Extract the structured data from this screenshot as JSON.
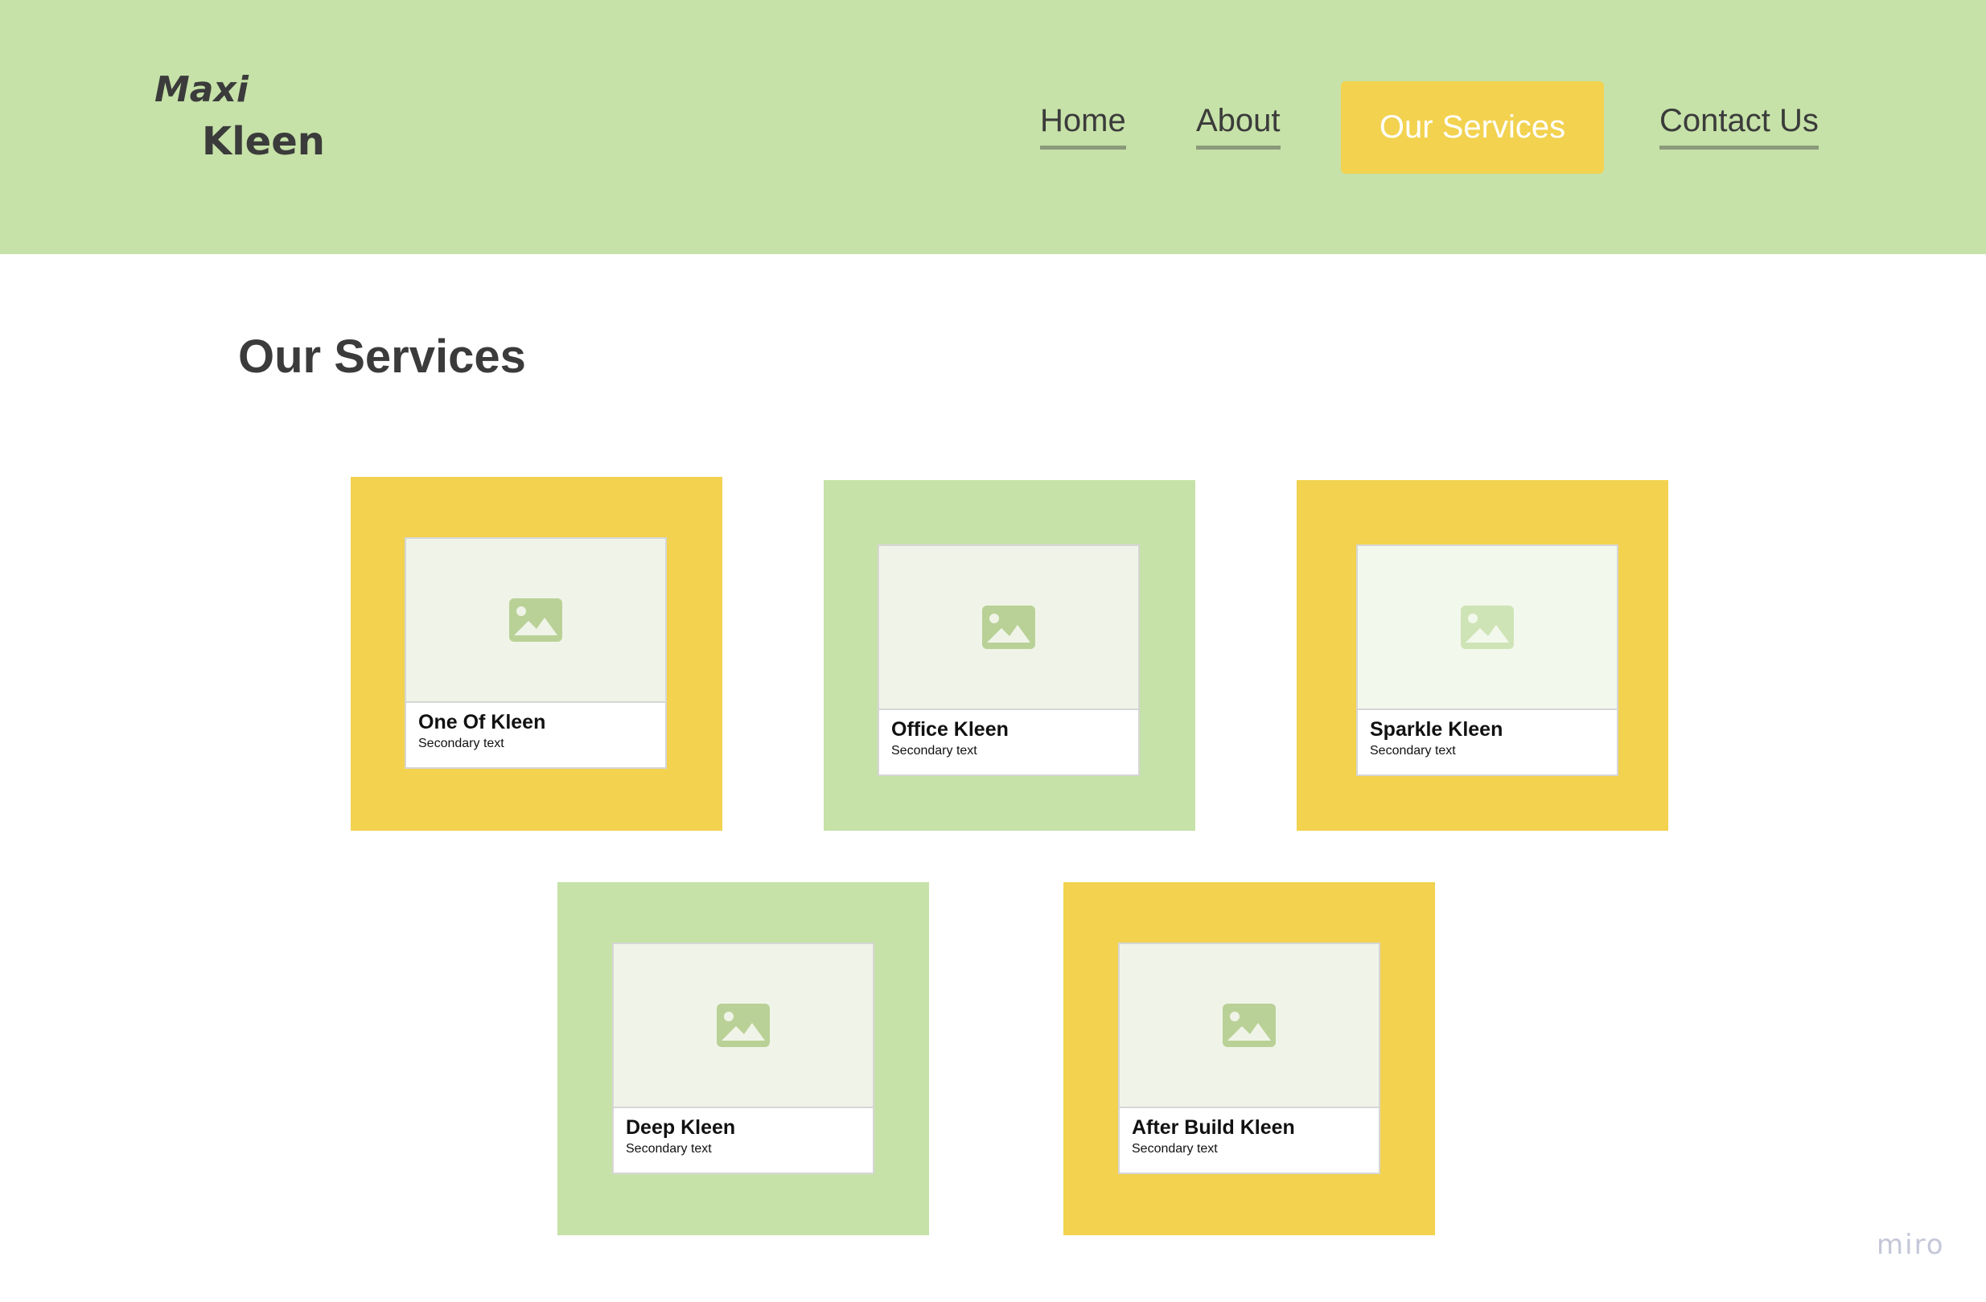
{
  "colors": {
    "header_bg": "#c6e2a8",
    "accent_yellow": "#f2d24f",
    "accent_green": "#c6e2a8",
    "text_dark": "#3b3b3b",
    "image_placeholder_icon": "#b9d196"
  },
  "brand": {
    "line1": "Maxi",
    "line2": "Kleen"
  },
  "nav": {
    "home": "Home",
    "about": "About",
    "services": "Our Services",
    "contact": "Contact Us",
    "active": "Our Services"
  },
  "main": {
    "title": "Our Services",
    "services": [
      {
        "name": "One Of Kleen",
        "sub": "Secondary text",
        "tile_color": "yellow",
        "icon": "image-placeholder-icon"
      },
      {
        "name": "Office Kleen",
        "sub": "Secondary text",
        "tile_color": "green",
        "icon": "image-placeholder-icon"
      },
      {
        "name": "Sparkle Kleen",
        "sub": "Secondary text",
        "tile_color": "yellow",
        "icon": "image-placeholder-icon"
      },
      {
        "name": "Deep Kleen",
        "sub": "Secondary text",
        "tile_color": "green",
        "icon": "image-placeholder-icon"
      },
      {
        "name": "After Build Kleen",
        "sub": "Secondary text",
        "tile_color": "yellow",
        "icon": "image-placeholder-icon"
      }
    ]
  },
  "watermark": "miro"
}
